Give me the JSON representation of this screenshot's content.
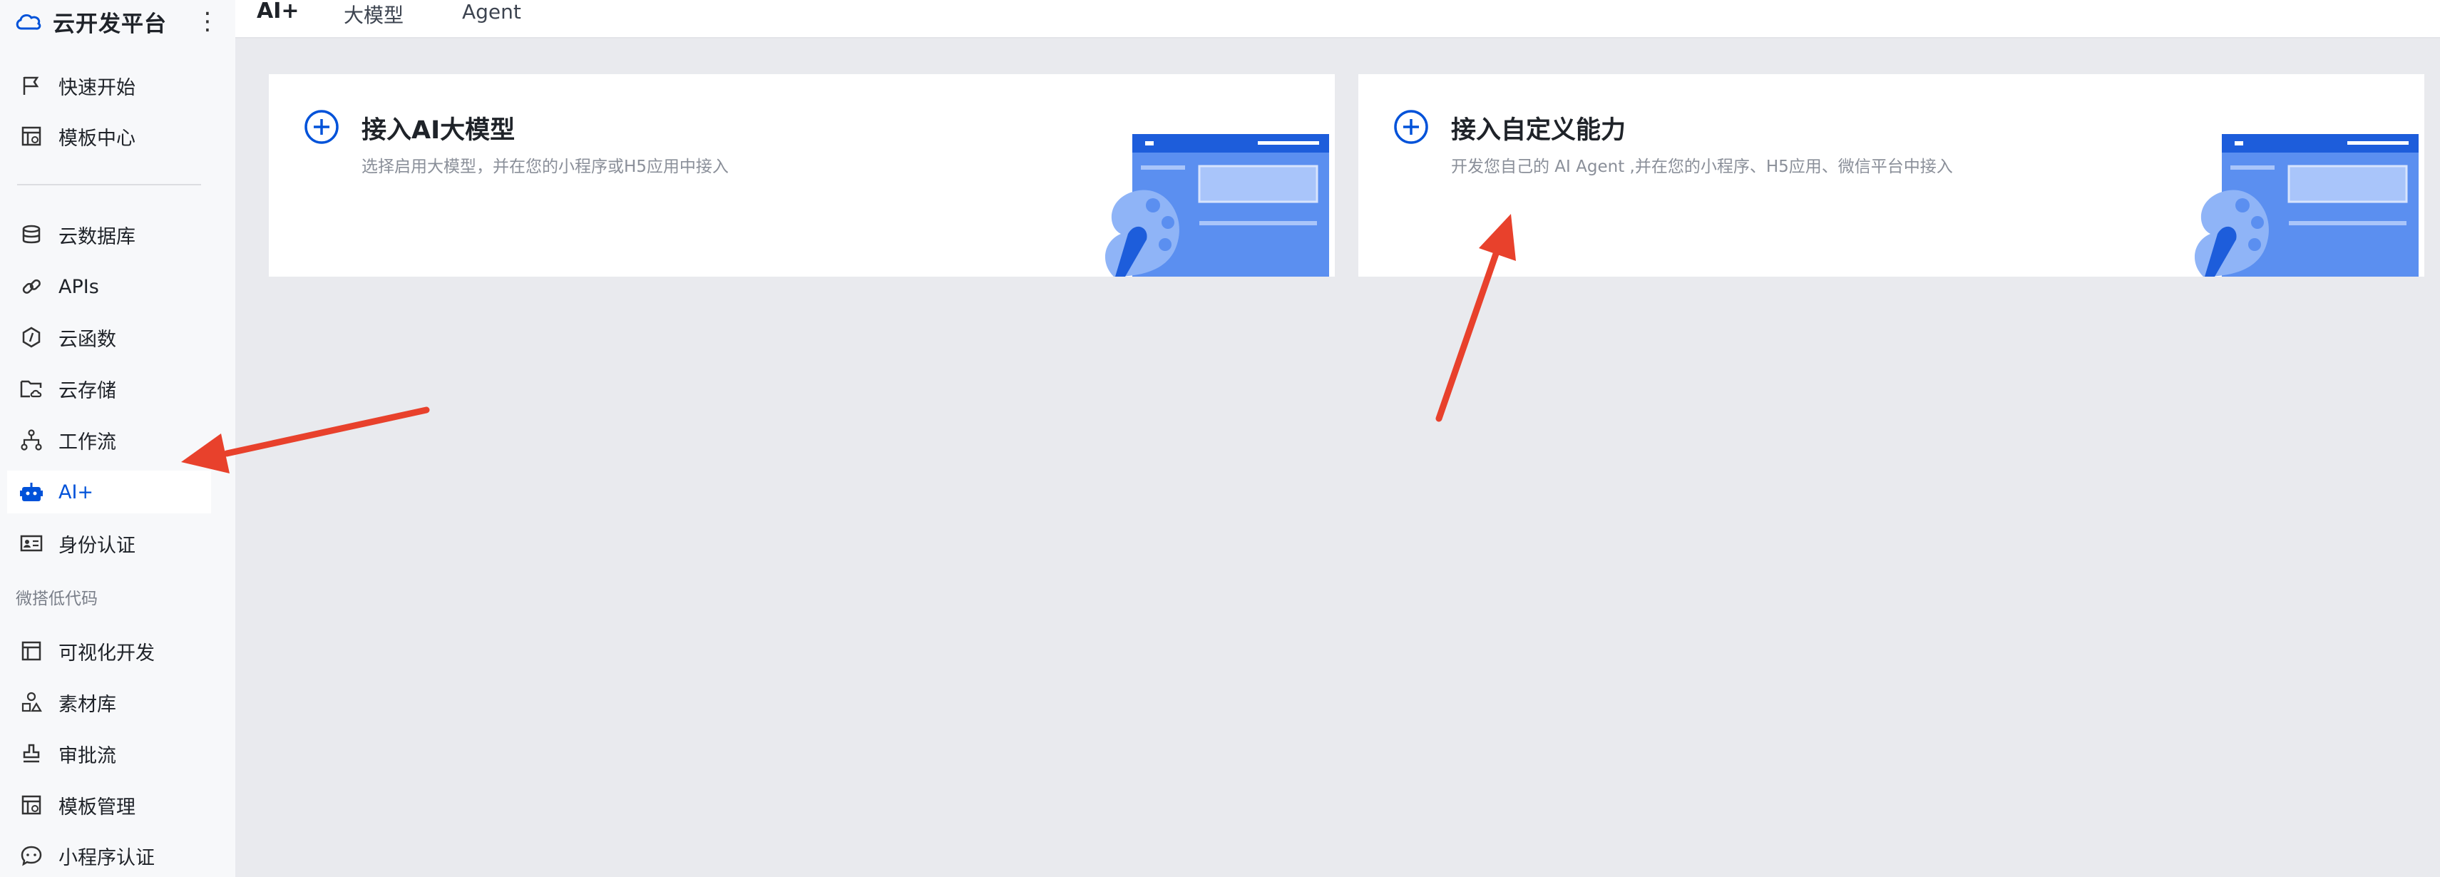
{
  "brand": {
    "title": "云开发平台",
    "more_icon": "more-vertical-icon"
  },
  "sidebar": {
    "items": [
      {
        "label": "快速开始",
        "icon": "flag-icon"
      },
      {
        "label": "模板中心",
        "icon": "template-icon"
      },
      {
        "label": "云数据库",
        "icon": "database-icon"
      },
      {
        "label": "APIs",
        "icon": "link-icon"
      },
      {
        "label": "云函数",
        "icon": "function-icon"
      },
      {
        "label": "云存储",
        "icon": "folder-cloud-icon"
      },
      {
        "label": "工作流",
        "icon": "workflow-icon"
      },
      {
        "label": "AI+",
        "icon": "robot-icon",
        "active": true
      },
      {
        "label": "身份认证",
        "icon": "id-card-icon"
      },
      {
        "label": "可视化开发",
        "icon": "layout-icon"
      },
      {
        "label": "素材库",
        "icon": "shapes-icon"
      },
      {
        "label": "审批流",
        "icon": "stamp-icon"
      },
      {
        "label": "模板管理",
        "icon": "template-manage-icon"
      },
      {
        "label": "小程序认证",
        "icon": "chat-bubble-icon"
      }
    ],
    "section_label": "微搭低代码"
  },
  "topbar": {
    "title": "AI+",
    "tabs": [
      "大模型",
      "Agent"
    ]
  },
  "cards": [
    {
      "title": "接入AI大模型",
      "desc": "选择启用大模型，并在您的小程序或H5应用中接入",
      "icon": "plus-circle-icon"
    },
    {
      "title": "接入自定义能力",
      "desc": "开发您自己的 AI Agent ,并在您的小程序、H5应用、微信平台中接入",
      "icon": "plus-circle-icon"
    }
  ],
  "colors": {
    "accent": "#0052d9",
    "arrow": "#e8412c",
    "background": "#e9eaee"
  }
}
